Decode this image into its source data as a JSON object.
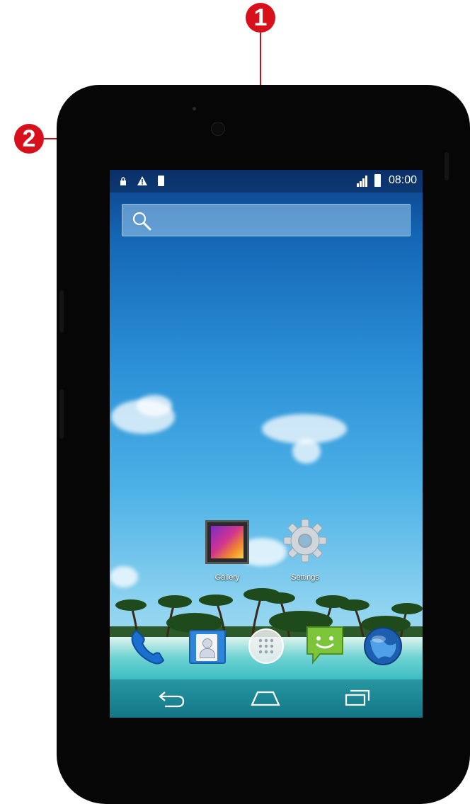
{
  "callouts": [
    {
      "number": "1"
    },
    {
      "number": "2"
    }
  ],
  "status_bar": {
    "time": "08:00",
    "left_icons": [
      "lock-icon",
      "warning-icon",
      "sd-card-icon"
    ],
    "right_icons": [
      "signal-icon",
      "battery-icon"
    ]
  },
  "search": {
    "icon": "search-icon"
  },
  "apps": [
    {
      "label": "Gallery",
      "icon": "gallery-icon"
    },
    {
      "label": "Settings",
      "icon": "settings-gear-icon"
    }
  ],
  "dock": [
    "phone-icon",
    "contacts-icon",
    "app-drawer-icon",
    "messaging-icon",
    "browser-globe-icon"
  ],
  "nav": [
    "back-icon",
    "home-icon",
    "recent-apps-icon"
  ],
  "colors": {
    "callout": "#d8101c",
    "phone_body": "#060606"
  }
}
